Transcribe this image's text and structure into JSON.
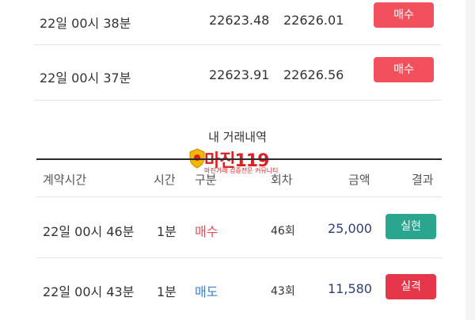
{
  "top_rows": [
    {
      "time": "22일 00시 38분",
      "val_a": "22623.48",
      "val_b": "22626.01",
      "action": "매수"
    },
    {
      "time": "22일 00시 37분",
      "val_a": "22623.91",
      "val_b": "22626.56",
      "action": "매수"
    }
  ],
  "history": {
    "title": "내 거래내역",
    "logo_word": "마진119",
    "logo_sub": "마진거래 검증전문 커뮤니티",
    "headers": [
      "계약시간",
      "시간",
      "구분",
      "회차",
      "금액",
      "결과"
    ],
    "rows": [
      {
        "time": "22일 00시 46분",
        "duration": "1분",
        "direction": "매수",
        "round": "46회",
        "amount": "25,000",
        "result": "실현"
      },
      {
        "time": "22일 00시 43분",
        "duration": "1분",
        "direction": "매도",
        "round": "43회",
        "amount": "11,580",
        "result": "실격"
      }
    ]
  },
  "colors": {
    "buy": "#e0505a",
    "sell": "#3a7fd0",
    "hit": "#2aa58e",
    "miss": "#e5364a",
    "action_button": "#f2505c"
  }
}
